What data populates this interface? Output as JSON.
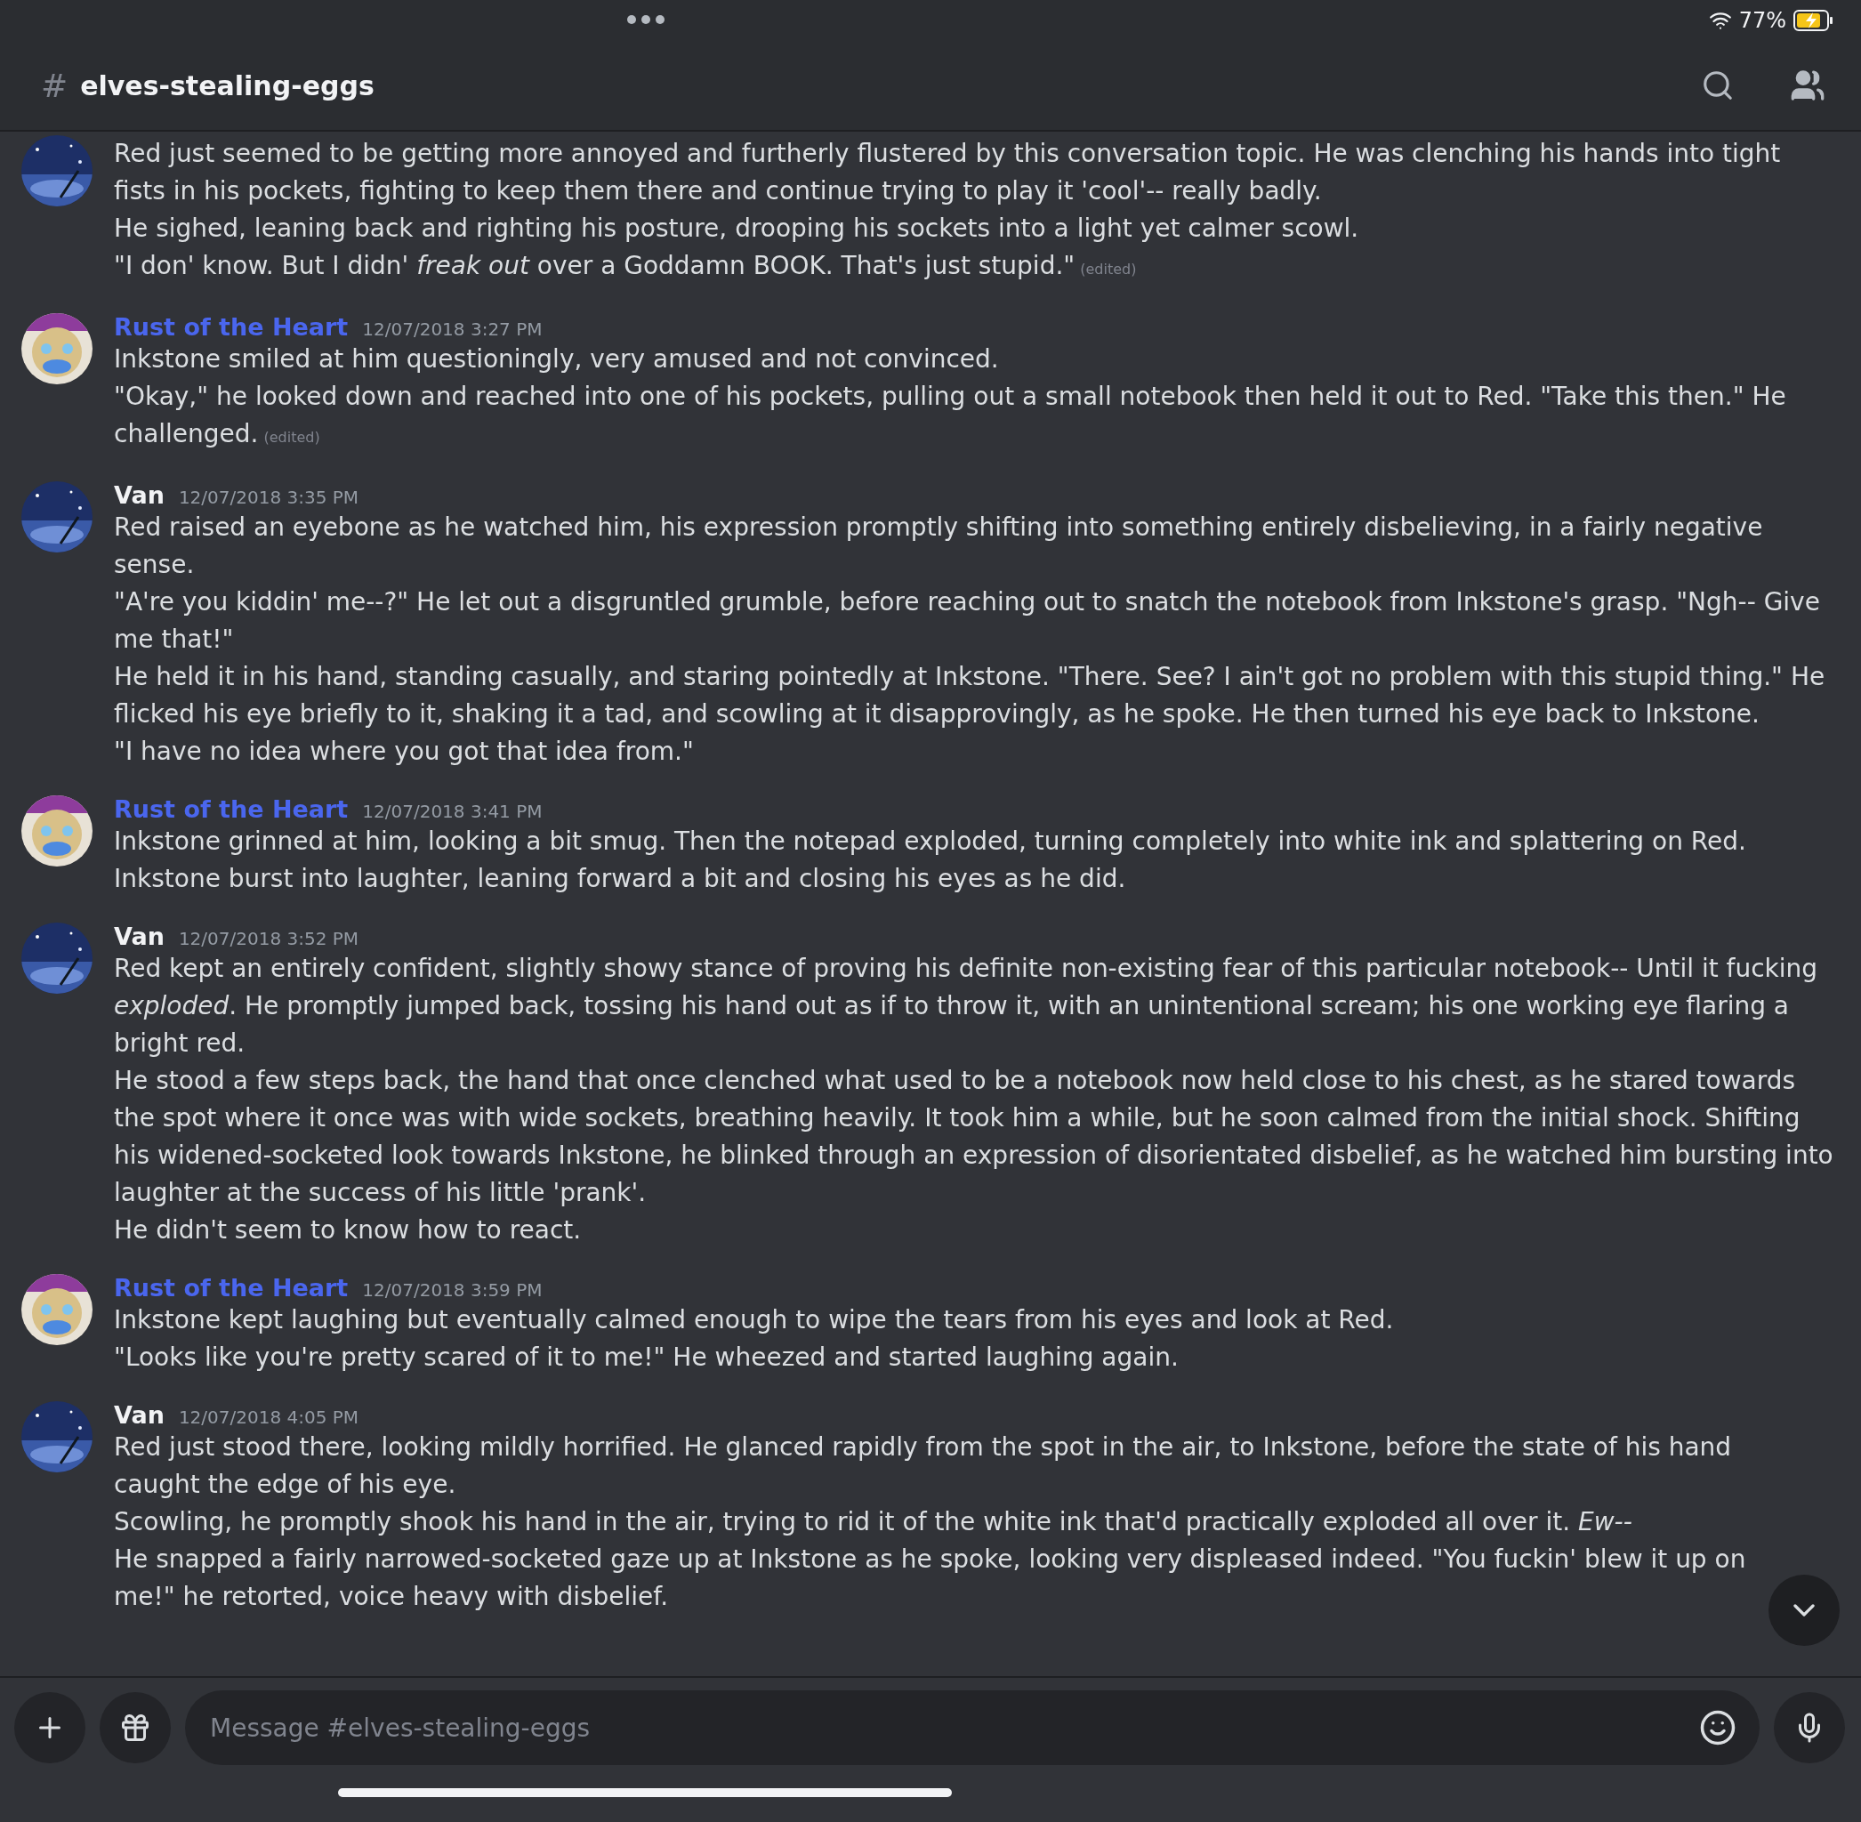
{
  "status_bar": {
    "battery": "77%"
  },
  "header": {
    "channel_icon": "#",
    "channel": "elves-stealing-eggs"
  },
  "messages": [
    {
      "avatar": {
        "kind": "picture"
      },
      "lines": [
        "Red just seemed to be getting more annoyed and furtherly flustered by this conversation topic. He was clenching his hands into tight fists in his pockets, fighting to keep them there and continue trying to play it 'cool'-- really badly.",
        "He sighed, leaning back and righting his posture, drooping his sockets into a light yet calmer scowl.",
        "\"I don' know. But I didn' *freak out* over a Goddamn BOOK. That's just stupid.\""
      ],
      "edited": "(edited)"
    },
    {
      "avatar": {
        "kind": "picture"
      },
      "author": "Rust of the Heart",
      "color": "#4a66ee",
      "time": "12/07/2018 3:27 PM",
      "lines": [
        "Inkstone smiled at him questioningly, very amused and not convinced.",
        "\"Okay,\" he looked down and reached into one of his pockets, pulling out a small notebook then held it out to Red. \"Take this then.\" He challenged."
      ],
      "edited": "(edited)"
    },
    {
      "avatar": {
        "kind": "picture"
      },
      "author": "Van",
      "color": "#f2f3f5",
      "time": "12/07/2018 3:35 PM",
      "lines": [
        "Red raised an eyebone as he watched him, his expression promptly shifting into something entirely disbelieving, in a fairly negative sense.",
        "\"A're you kiddin' me--?\" He let out a disgruntled grumble, before reaching out to snatch the notebook from Inkstone's grasp. \"Ngh-- Give me that!\"",
        "He held it in his hand, standing casually, and staring pointedly at Inkstone. \"There. See? I ain't got no problem with this stupid thing.\" He flicked his eye briefly to it, shaking it a tad, and scowling at it disapprovingly, as he spoke. He then turned his eye back to Inkstone.",
        "\"I have no idea where you got that idea from.\""
      ]
    },
    {
      "avatar": {
        "kind": "picture"
      },
      "author": "Rust of the Heart",
      "color": "#4a66ee",
      "time": "12/07/2018 3:41 PM",
      "lines": [
        "Inkstone grinned at him, looking a bit smug. Then the notepad exploded, turning completely into white ink and splattering on Red.",
        "Inkstone burst into laughter, leaning forward a bit and closing his eyes as he did."
      ]
    },
    {
      "avatar": {
        "kind": "picture"
      },
      "author": "Van",
      "color": "#f2f3f5",
      "time": "12/07/2018 3:52 PM",
      "lines": [
        "Red kept an entirely confident, slightly showy stance of proving his definite non-existing fear of this particular notebook-- Until it fucking *exploded*. He promptly jumped back, tossing his hand out as if to throw it, with an unintentional scream; his one working eye flaring a bright red.",
        "He stood a few steps back, the hand that once clenched what used to be a notebook now held close to his chest, as he stared towards the spot where it once was with wide sockets, breathing heavily. It took him a while, but he soon calmed from the initial shock. Shifting his widened-socketed look towards Inkstone, he blinked through an expression of disorientated disbelief, as he watched him bursting into laughter at the success of his little 'prank'.",
        "He didn't seem to know how to react."
      ]
    },
    {
      "avatar": {
        "kind": "picture"
      },
      "author": "Rust of the Heart",
      "color": "#4a66ee",
      "time": "12/07/2018 3:59 PM",
      "lines": [
        "Inkstone kept laughing but eventually calmed enough to wipe the tears from his eyes and look at Red.",
        "\"Looks like you're pretty scared of it to me!\" He wheezed and started laughing again."
      ]
    },
    {
      "avatar": {
        "kind": "picture"
      },
      "author": "Van",
      "color": "#f2f3f5",
      "time": "12/07/2018 4:05 PM",
      "lines": [
        "Red just stood there, looking mildly horrified. He glanced rapidly from the spot in the air, to Inkstone, before the state of his hand caught the edge of his eye.",
        "Scowling, he promptly shook his hand in the air, trying to rid it of the white ink that'd practically exploded all over it. *Ew--*",
        "He snapped a fairly narrowed-socketed gaze up at Inkstone as he spoke, looking very displeased indeed. \"You fuckin' blew it up on me!\" he retorted, voice heavy with disbelief."
      ]
    }
  ],
  "composer": {
    "placeholder": "Message #elves-stealing-eggs"
  }
}
